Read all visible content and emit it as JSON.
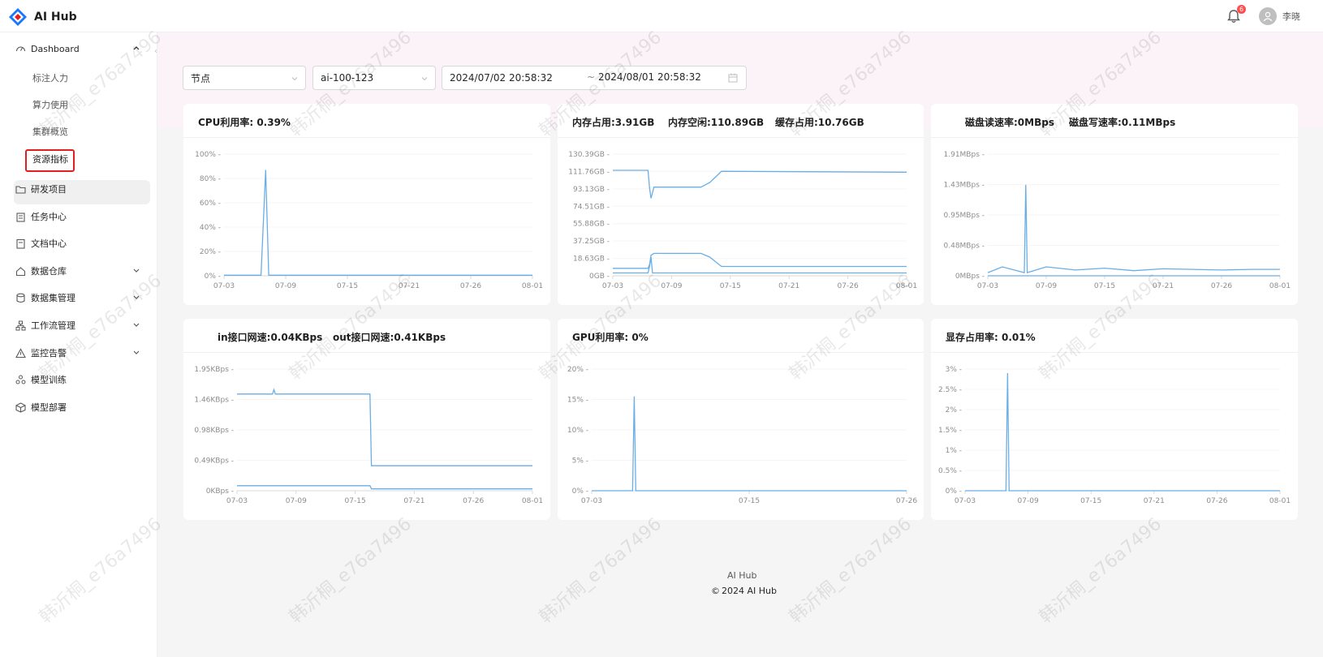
{
  "app": {
    "title": "AI Hub",
    "notification_count": "6",
    "username": "李晓"
  },
  "sidebar": {
    "dashboard": "Dashboard",
    "sub_items": [
      "标注人力",
      "算力使用",
      "集群概览",
      "资源指标"
    ],
    "items": [
      "研发项目",
      "任务中心",
      "文档中心",
      "数据仓库",
      "数据集管理",
      "工作流管理",
      "监控告警",
      "模型训练",
      "模型部署"
    ]
  },
  "filters": {
    "node_type": "节点",
    "node": "ai-100-123",
    "start_time": "2024/07/02 20:58:32",
    "range_sep": "~",
    "end_time": "2024/08/01 20:58:32"
  },
  "cards": {
    "cpu": {
      "title": "CPU利用率: 0.39%"
    },
    "memory": {
      "title1": "内存占用:3.91GB",
      "title2": "内存空闲:110.89GB",
      "title3": "缓存占用:10.76GB"
    },
    "disk": {
      "title1": "磁盘读速率:0MBps",
      "title2": "磁盘写速率:0.11MBps"
    },
    "network": {
      "title1": "in接口网速:0.04KBps",
      "title2": "out接口网速:0.41KBps"
    },
    "gpu": {
      "title": "GPU利用率: 0%"
    },
    "vram": {
      "title": "显存占用率: 0.01%"
    }
  },
  "chart_data": [
    {
      "type": "line",
      "id": "cpu",
      "title": "CPU利用率: 0.39%",
      "x_ticks": [
        "07-03",
        "07-09",
        "07-15",
        "07-21",
        "07-26",
        "08-01"
      ],
      "y_ticks": [
        "100% -",
        "80% -",
        "60% -",
        "40% -",
        "20% -",
        "0% -"
      ],
      "ylim": [
        0,
        100
      ],
      "series": [
        {
          "x": [
            0,
            0.12,
            0.135,
            0.145,
            0.155,
            1
          ],
          "y": [
            0.5,
            0.5,
            87,
            0.5,
            0.5,
            0.5
          ]
        }
      ]
    },
    {
      "type": "line",
      "id": "memory",
      "x_ticks": [
        "07-03",
        "07-09",
        "07-15",
        "07-21",
        "07-26",
        "08-01"
      ],
      "y_ticks": [
        "130.39GB -",
        "111.76GB -",
        "93.13GB -",
        "74.51GB -",
        "55.88GB -",
        "37.25GB -",
        "18.63GB -",
        "0GB -"
      ],
      "ylim": [
        0,
        130.39
      ],
      "series": [
        {
          "x": [
            0,
            0.12,
            0.125,
            0.13,
            0.14,
            0.3,
            0.33,
            0.35,
            0.37,
            1
          ],
          "y": [
            113,
            113,
            94,
            83,
            95,
            95,
            100,
            106,
            112,
            111
          ]
        },
        {
          "x": [
            0,
            0.12,
            0.125,
            0.13,
            0.14,
            0.3,
            0.33,
            0.35,
            0.37,
            1
          ],
          "y": [
            8,
            8,
            12,
            22,
            24,
            24,
            20,
            15,
            10,
            10
          ]
        },
        {
          "x": [
            0,
            0.12,
            0.125,
            0.13,
            0.135,
            0.14,
            1
          ],
          "y": [
            3,
            3,
            10,
            20,
            3,
            3,
            3
          ]
        }
      ]
    },
    {
      "type": "line",
      "id": "disk",
      "x_ticks": [
        "07-03",
        "07-09",
        "07-15",
        "07-21",
        "07-26",
        "08-01"
      ],
      "y_ticks": [
        "1.91MBps -",
        "1.43MBps -",
        "0.95MBps -",
        "0.48MBps -",
        "0MBps -"
      ],
      "ylim": [
        0,
        1.91
      ],
      "series": [
        {
          "x": [
            0,
            0.05,
            0.1,
            0.125,
            0.13,
            0.135,
            0.2,
            0.3,
            0.4,
            0.5,
            0.6,
            0.7,
            0.8,
            0.9,
            1
          ],
          "y": [
            0.05,
            0.14,
            0.08,
            0.05,
            1.43,
            0.05,
            0.14,
            0.09,
            0.12,
            0.08,
            0.11,
            0.1,
            0.09,
            0.1,
            0.1
          ]
        },
        {
          "x": [
            0,
            1
          ],
          "y": [
            0,
            0
          ]
        }
      ]
    },
    {
      "type": "line",
      "id": "network",
      "x_ticks": [
        "07-03",
        "07-09",
        "07-15",
        "07-21",
        "07-26",
        "08-01"
      ],
      "y_ticks": [
        "1.95KBps -",
        "1.46KBps -",
        "0.98KBps -",
        "0.49KBps -",
        "0KBps -"
      ],
      "ylim": [
        0,
        1.95
      ],
      "series": [
        {
          "x": [
            0,
            0.12,
            0.125,
            0.13,
            0.45,
            0.455,
            1
          ],
          "y": [
            1.55,
            1.55,
            1.62,
            1.55,
            1.55,
            0.4,
            0.4
          ]
        },
        {
          "x": [
            0,
            0.45,
            0.455,
            1
          ],
          "y": [
            0.08,
            0.08,
            0.03,
            0.03
          ]
        }
      ]
    },
    {
      "type": "line",
      "id": "gpu",
      "x_ticks": [
        "07-03",
        "07-15",
        "07-26"
      ],
      "y_ticks": [
        "20% -",
        "15% -",
        "10% -",
        "5% -",
        "0% -"
      ],
      "ylim": [
        0,
        20
      ],
      "series": [
        {
          "x": [
            0,
            0.13,
            0.135,
            0.14,
            1
          ],
          "y": [
            0,
            0,
            15.5,
            0,
            0
          ]
        }
      ]
    },
    {
      "type": "line",
      "id": "vram",
      "x_ticks": [
        "07-03",
        "07-09",
        "07-15",
        "07-21",
        "07-26",
        "08-01"
      ],
      "y_ticks": [
        "3% -",
        "2.5% -",
        "2% -",
        "1.5% -",
        "1% -",
        "0.5% -",
        "0% -"
      ],
      "ylim": [
        0,
        3
      ],
      "series": [
        {
          "x": [
            0,
            0.13,
            0.135,
            0.14,
            1
          ],
          "y": [
            0,
            0,
            2.9,
            0,
            0
          ]
        }
      ]
    }
  ],
  "footer": {
    "line1": "AI Hub",
    "copyright_symbol": "©",
    "line2": "2024 AI Hub"
  },
  "watermark": "韩沂桐_e76a7496",
  "colors": {
    "accent": "#1677ff",
    "line": "#6aaee6",
    "selected_border": "#e0201f",
    "badge": "#ff4d4f"
  }
}
